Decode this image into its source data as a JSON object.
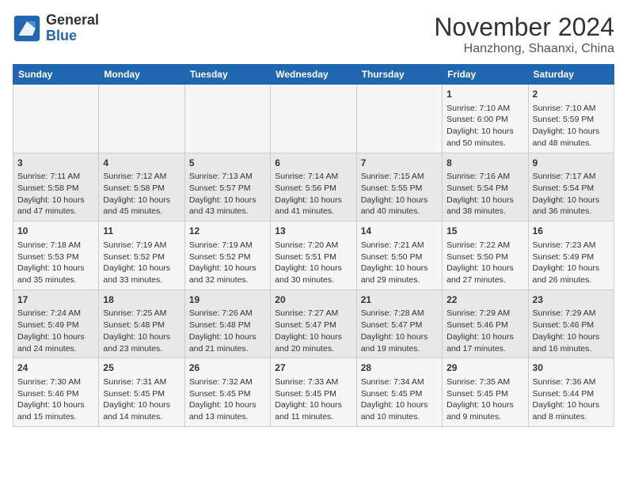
{
  "logo": {
    "general": "General",
    "blue": "Blue"
  },
  "header": {
    "month": "November 2024",
    "location": "Hanzhong, Shaanxi, China"
  },
  "weekdays": [
    "Sunday",
    "Monday",
    "Tuesday",
    "Wednesday",
    "Thursday",
    "Friday",
    "Saturday"
  ],
  "weeks": [
    [
      {
        "day": "",
        "info": ""
      },
      {
        "day": "",
        "info": ""
      },
      {
        "day": "",
        "info": ""
      },
      {
        "day": "",
        "info": ""
      },
      {
        "day": "",
        "info": ""
      },
      {
        "day": "1",
        "info": "Sunrise: 7:10 AM\nSunset: 6:00 PM\nDaylight: 10 hours\nand 50 minutes."
      },
      {
        "day": "2",
        "info": "Sunrise: 7:10 AM\nSunset: 5:59 PM\nDaylight: 10 hours\nand 48 minutes."
      }
    ],
    [
      {
        "day": "3",
        "info": "Sunrise: 7:11 AM\nSunset: 5:58 PM\nDaylight: 10 hours\nand 47 minutes."
      },
      {
        "day": "4",
        "info": "Sunrise: 7:12 AM\nSunset: 5:58 PM\nDaylight: 10 hours\nand 45 minutes."
      },
      {
        "day": "5",
        "info": "Sunrise: 7:13 AM\nSunset: 5:57 PM\nDaylight: 10 hours\nand 43 minutes."
      },
      {
        "day": "6",
        "info": "Sunrise: 7:14 AM\nSunset: 5:56 PM\nDaylight: 10 hours\nand 41 minutes."
      },
      {
        "day": "7",
        "info": "Sunrise: 7:15 AM\nSunset: 5:55 PM\nDaylight: 10 hours\nand 40 minutes."
      },
      {
        "day": "8",
        "info": "Sunrise: 7:16 AM\nSunset: 5:54 PM\nDaylight: 10 hours\nand 38 minutes."
      },
      {
        "day": "9",
        "info": "Sunrise: 7:17 AM\nSunset: 5:54 PM\nDaylight: 10 hours\nand 36 minutes."
      }
    ],
    [
      {
        "day": "10",
        "info": "Sunrise: 7:18 AM\nSunset: 5:53 PM\nDaylight: 10 hours\nand 35 minutes."
      },
      {
        "day": "11",
        "info": "Sunrise: 7:19 AM\nSunset: 5:52 PM\nDaylight: 10 hours\nand 33 minutes."
      },
      {
        "day": "12",
        "info": "Sunrise: 7:19 AM\nSunset: 5:52 PM\nDaylight: 10 hours\nand 32 minutes."
      },
      {
        "day": "13",
        "info": "Sunrise: 7:20 AM\nSunset: 5:51 PM\nDaylight: 10 hours\nand 30 minutes."
      },
      {
        "day": "14",
        "info": "Sunrise: 7:21 AM\nSunset: 5:50 PM\nDaylight: 10 hours\nand 29 minutes."
      },
      {
        "day": "15",
        "info": "Sunrise: 7:22 AM\nSunset: 5:50 PM\nDaylight: 10 hours\nand 27 minutes."
      },
      {
        "day": "16",
        "info": "Sunrise: 7:23 AM\nSunset: 5:49 PM\nDaylight: 10 hours\nand 26 minutes."
      }
    ],
    [
      {
        "day": "17",
        "info": "Sunrise: 7:24 AM\nSunset: 5:49 PM\nDaylight: 10 hours\nand 24 minutes."
      },
      {
        "day": "18",
        "info": "Sunrise: 7:25 AM\nSunset: 5:48 PM\nDaylight: 10 hours\nand 23 minutes."
      },
      {
        "day": "19",
        "info": "Sunrise: 7:26 AM\nSunset: 5:48 PM\nDaylight: 10 hours\nand 21 minutes."
      },
      {
        "day": "20",
        "info": "Sunrise: 7:27 AM\nSunset: 5:47 PM\nDaylight: 10 hours\nand 20 minutes."
      },
      {
        "day": "21",
        "info": "Sunrise: 7:28 AM\nSunset: 5:47 PM\nDaylight: 10 hours\nand 19 minutes."
      },
      {
        "day": "22",
        "info": "Sunrise: 7:29 AM\nSunset: 5:46 PM\nDaylight: 10 hours\nand 17 minutes."
      },
      {
        "day": "23",
        "info": "Sunrise: 7:29 AM\nSunset: 5:46 PM\nDaylight: 10 hours\nand 16 minutes."
      }
    ],
    [
      {
        "day": "24",
        "info": "Sunrise: 7:30 AM\nSunset: 5:46 PM\nDaylight: 10 hours\nand 15 minutes."
      },
      {
        "day": "25",
        "info": "Sunrise: 7:31 AM\nSunset: 5:45 PM\nDaylight: 10 hours\nand 14 minutes."
      },
      {
        "day": "26",
        "info": "Sunrise: 7:32 AM\nSunset: 5:45 PM\nDaylight: 10 hours\nand 13 minutes."
      },
      {
        "day": "27",
        "info": "Sunrise: 7:33 AM\nSunset: 5:45 PM\nDaylight: 10 hours\nand 11 minutes."
      },
      {
        "day": "28",
        "info": "Sunrise: 7:34 AM\nSunset: 5:45 PM\nDaylight: 10 hours\nand 10 minutes."
      },
      {
        "day": "29",
        "info": "Sunrise: 7:35 AM\nSunset: 5:45 PM\nDaylight: 10 hours\nand 9 minutes."
      },
      {
        "day": "30",
        "info": "Sunrise: 7:36 AM\nSunset: 5:44 PM\nDaylight: 10 hours\nand 8 minutes."
      }
    ]
  ]
}
